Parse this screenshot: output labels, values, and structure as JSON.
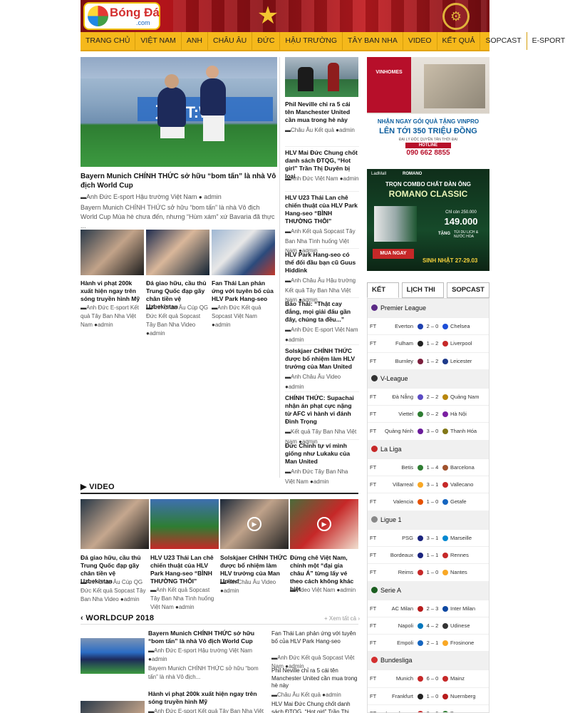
{
  "site": {
    "logo_text": "Bóng Đá",
    "logo_sub": ".com"
  },
  "nav": [
    "TRANG CHỦ",
    "VIỆT NAM",
    "ANH",
    "CHÂU ÂU",
    "ĐỨC",
    "HẬU TRƯỜNG",
    "TÂY BAN NHA",
    "VIDEO",
    "KẾT QUẢ",
    "SOPCAST",
    "E-SPORT"
  ],
  "hero": {
    "title": "Bayern Munich CHÍNH THỨC sở hữu “bom tấn” là nhà Vô địch World Cup",
    "meta_cats": "Anh Đức E-sport Hậu trường Việt Nam",
    "author": "admin",
    "excerpt": "Bayern Munich CHÍNH THỨC sở hữu “bom tấn” là nhà Vô địch World Cup Mùa hè chưa đến, nhưng “Hùm xám” xứ Bavaria đã thực ..."
  },
  "small_cards": [
    {
      "title": "Hành vi phạt 200k xuất hiện ngay trên sóng truyền hình Mỹ",
      "cats": "Anh Đức E-sport Kết quả Tây Ban Nha Việt Nam",
      "author": "admin"
    },
    {
      "title": "Đá giao hữu, cầu thủ Trung Quốc đạp gãy chân tiền vệ Uzbekistan",
      "cats": "Anh Châu Âu Cúp QG Đức Kết quả Sopcast Tây Ban Nha Video",
      "author": "admin"
    },
    {
      "title": "Fan Thái Lan phản ứng với tuyên bố của HLV Park Hang-seo",
      "cats": "Anh Đức Kết quả Sopcast Việt Nam",
      "author": "admin"
    }
  ],
  "mid_list": [
    {
      "title": "Phil Neville chỉ ra 5 cái tên Manchester United cần mua trong hè này",
      "cats": "Châu Âu Kết quả",
      "author": "admin"
    },
    {
      "title": "HLV Mai Đức Chung chốt danh sách ĐTQG, “Hot girl” Trần Thị Duyên bị loại",
      "cats": "Anh Đức Việt Nam",
      "author": "admin"
    },
    {
      "title": "HLV U23 Thái Lan chê chiến thuật của HLV Park Hang-seo “BÌNH THƯỜNG THÔI”",
      "cats": "Anh Kết quả Sopcast Tây Ban Nha Tình huống Việt Nam",
      "author": "admin"
    },
    {
      "title": "HLV Park Hang-seo có thể đối đầu bạn cũ Guus Hiddink",
      "cats": "Anh Châu Âu Hậu trường Kết quả Tây Ban Nha Việt Nam",
      "author": "admin"
    },
    {
      "title": "Báo Thái: “Thật cay đắng, mọi giải đấu gần đây, chúng ta đều...”",
      "cats": "Anh Đức E-sport Việt Nam",
      "author": "admin"
    },
    {
      "title": "Solskjaer CHÍNH THỨC được bổ nhiệm làm HLV trưởng của Man United",
      "cats": "Anh Châu Âu Video",
      "author": "admin"
    },
    {
      "title": "CHÍNH THỨC: Supachai nhận án phạt cực nặng từ AFC vì hành vi đánh Đình Trọng",
      "cats": "Kết quả Tây Ban Nha Việt Nam",
      "author": "admin"
    },
    {
      "title": "Đức Chinh tự ví mình giống như Lukaku của Man United",
      "cats": "Anh Đức Tây Ban Nha Việt Nam",
      "author": "admin"
    }
  ],
  "video": {
    "heading": "VIDEO",
    "items": [
      {
        "title": "Đá giao hữu, cầu thủ Trung Quốc đạp gãy chân tiền vệ Uzbekistan",
        "cats": "Anh Châu Âu Cúp QG Đức Kết quả Sopcast Tây Ban Nha Video",
        "author": "admin"
      },
      {
        "title": "HLV U23 Thái Lan chê chiến thuật của HLV Park Hang-seo “BÌNH THƯỜNG THÔI”",
        "cats": "Anh Kết quả Sopcast Tây Ban Nha Tình huống Việt Nam",
        "author": "admin"
      },
      {
        "title": "Solskjaer CHÍNH THỨC được bổ nhiệm làm HLV trưởng của Man United",
        "cats": "Anh Châu Âu Video",
        "author": "admin"
      },
      {
        "title": "Đừng chê Việt Nam, chính một “đại gia châu Á” từng lấy vé theo cách không khác biệt",
        "cats": "Video Việt Nam",
        "author": "admin"
      }
    ]
  },
  "worldcup": {
    "heading": "WORLDCUP 2018",
    "more": "+ Xem tất cả",
    "left": [
      {
        "title": "Bayern Munich CHÍNH THỨC sở hữu “bom tấn” là nhà Vô địch World Cup",
        "cats": "Anh Đức E-sport Hậu trường Việt Nam",
        "author": "admin",
        "excerpt": "Bayern Munich CHÍNH THỨC sở hữu “bom tấn” là nhà Vô địch..."
      },
      {
        "title": "Hành vi phạt 200k xuất hiện ngay trên sóng truyền hình Mỹ",
        "cats": "Anh Đức E-sport Kết quả Tây Ban Nha Việt Nam",
        "author": "admin"
      }
    ],
    "right": [
      {
        "title": "Fan Thái Lan phản ứng với tuyên bố của HLV Park Hang-seo",
        "cats": "Anh Đức Kết quả Sopcast Việt Nam",
        "author": "admin"
      },
      {
        "title": "Phil Neville chỉ ra 5 cái tên Manchester United cần mua trong hè này",
        "cats": "Châu Âu Kết quả",
        "author": "admin"
      },
      {
        "title": "HLV Mai Đức Chung chốt danh sách ĐTQG, “Hot girl” Trần Thị Duyên bị",
        "cats": "",
        "author": ""
      }
    ]
  },
  "ads": {
    "vinhomes": {
      "brand": "VINHOMES",
      "line1": "NHẬN NGAY GÓI QUÀ TẶNG VINPRO",
      "line2": "LÊN TỚI 350 TRIỆU ĐỒNG",
      "line3": "ĐẠI LÝ ĐỘC QUYỀN TẢN THỜI ĐẠI",
      "hotline_label": "HOTLINE",
      "phone": "090 662 8855"
    },
    "romano": {
      "brand1": "LadMall",
      "brand2": "ROMANO",
      "line1": "TRỌN COMBO CHẤT ĐÀN ÔNG",
      "line2": "ROMANO CLASSIC",
      "price_old": "Chỉ còn 250.000",
      "price": "149.000",
      "gift": "TẶNG",
      "gift_note": "TÚI DU LỊCH & NƯỚC HOA",
      "cta": "MUA NGAY",
      "date": "SINH NHẬT 27-29.03"
    }
  },
  "score_tabs": [
    "KẾT QUẢ",
    "LỊCH THI ĐẤU",
    "SOPCAST"
  ],
  "leagues": [
    {
      "name": "Premier League",
      "color": "#5b2a86",
      "matches": [
        {
          "st": "FT",
          "home": "Everton",
          "score": "2 – 0",
          "away": "Chelsea",
          "hc": "#1e40af",
          "ac": "#1d4ed8"
        },
        {
          "st": "FT",
          "home": "Fulham",
          "score": "1 – 2",
          "away": "Liverpool",
          "hc": "#222222",
          "ac": "#c62828"
        },
        {
          "st": "FT",
          "home": "Burnley",
          "score": "1 – 2",
          "away": "Leicester",
          "hc": "#7b1e3c",
          "ac": "#1e3a8a"
        }
      ]
    },
    {
      "name": "V-League",
      "color": "#333333",
      "matches": [
        {
          "st": "FT",
          "home": "Đà Nẵng",
          "score": "2 – 2",
          "away": "Quảng Nam",
          "hc": "#5b4bc4",
          "ac": "#b8860b"
        },
        {
          "st": "FT",
          "home": "Viettel",
          "score": "0 – 2",
          "away": "Hà Nội",
          "hc": "#2e7d32",
          "ac": "#7b1fa2"
        },
        {
          "st": "FT",
          "home": "Quảng Ninh",
          "score": "3 – 0",
          "away": "Thanh Hóa",
          "hc": "#6a1b9a",
          "ac": "#827717"
        }
      ]
    },
    {
      "name": "La Liga",
      "color": "#c62828",
      "matches": [
        {
          "st": "FT",
          "home": "Betis",
          "score": "1 – 4",
          "away": "Barcelona",
          "hc": "#2e7d32",
          "ac": "#a0522d"
        },
        {
          "st": "FT",
          "home": "Villarreal",
          "score": "3 – 1",
          "away": "Vallecano",
          "hc": "#f9a825",
          "ac": "#c62828"
        },
        {
          "st": "FT",
          "home": "Valencia",
          "score": "1 – 0",
          "away": "Getafe",
          "hc": "#e65100",
          "ac": "#1565c0"
        }
      ]
    },
    {
      "name": "Ligue 1",
      "color": "#888888",
      "matches": [
        {
          "st": "FT",
          "home": "PSG",
          "score": "3 – 1",
          "away": "Marseille",
          "hc": "#1a237e",
          "ac": "#0288d1"
        },
        {
          "st": "FT",
          "home": "Bordeaux",
          "score": "1 – 1",
          "away": "Rennes",
          "hc": "#1a237e",
          "ac": "#c62828"
        },
        {
          "st": "FT",
          "home": "Reims",
          "score": "1 – 0",
          "away": "Nantes",
          "hc": "#c62828",
          "ac": "#f9a825"
        }
      ]
    },
    {
      "name": "Serie A",
      "color": "#1b5e20",
      "matches": [
        {
          "st": "FT",
          "home": "AC Milan",
          "score": "2 – 3",
          "away": "Inter Milan",
          "hc": "#b71c1c",
          "ac": "#0d47a1"
        },
        {
          "st": "FT",
          "home": "Napoli",
          "score": "4 – 2",
          "away": "Udinese",
          "hc": "#0277bd",
          "ac": "#333333"
        },
        {
          "st": "FT",
          "home": "Empoli",
          "score": "2 – 1",
          "away": "Frosinone",
          "hc": "#1565c0",
          "ac": "#f9a825"
        }
      ]
    },
    {
      "name": "Bundesliga",
      "color": "#d32f2f",
      "matches": [
        {
          "st": "FT",
          "home": "Munich",
          "score": "6 – 0",
          "away": "Mainz",
          "hc": "#c62828",
          "ac": "#c62828"
        },
        {
          "st": "FT",
          "home": "Frankfurt",
          "score": "1 – 0",
          "away": "Nuernberg",
          "hc": "#222222",
          "ac": "#b71c1c"
        },
        {
          "st": "FT",
          "home": "Leverkusen",
          "score": "3 – 0",
          "away": "Bremen",
          "hc": "#c62828",
          "ac": "#2e7d32"
        }
      ]
    }
  ]
}
